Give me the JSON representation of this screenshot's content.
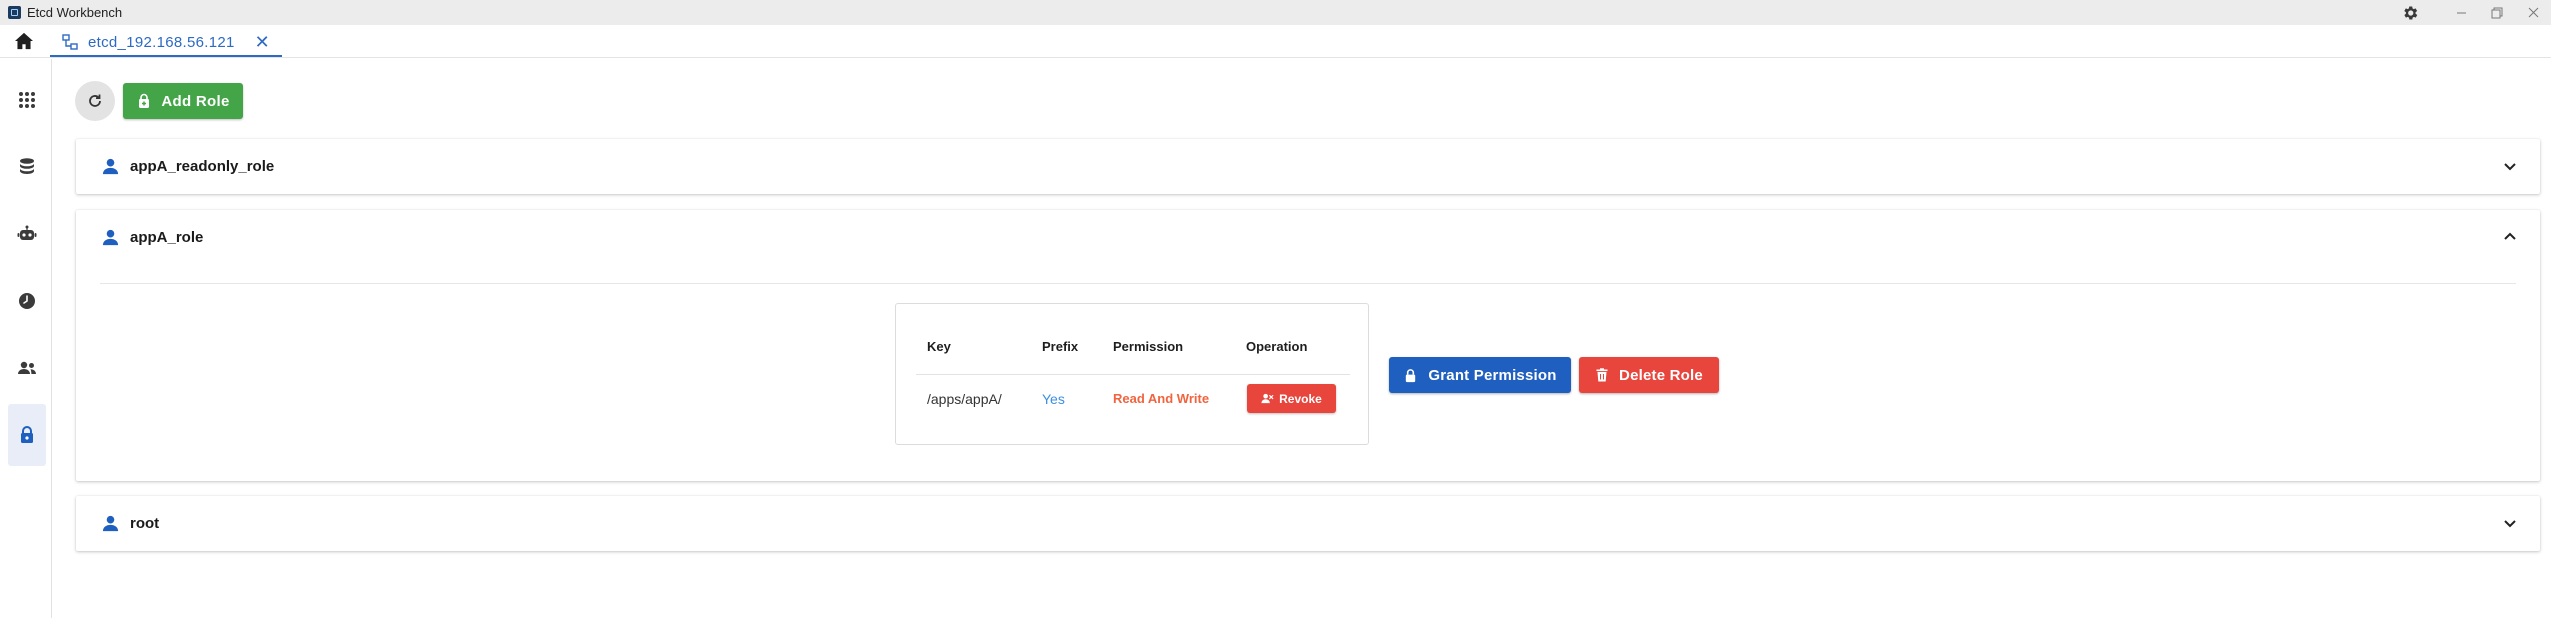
{
  "window": {
    "title": "Etcd Workbench"
  },
  "tabs": [
    {
      "label": "etcd_192.168.56.121"
    }
  ],
  "sidebar": {
    "items": [
      {
        "icon": "apps-grid-icon"
      },
      {
        "icon": "database-icon"
      },
      {
        "icon": "robot-icon"
      },
      {
        "icon": "clock-icon"
      },
      {
        "icon": "users-icon"
      },
      {
        "icon": "lock-icon",
        "active": true
      }
    ]
  },
  "toolbar": {
    "add_role_label": "Add Role"
  },
  "roles": [
    {
      "name": "appA_readonly_role",
      "expanded": false
    },
    {
      "name": "appA_role",
      "expanded": true,
      "table": {
        "headers": [
          "Key",
          "Prefix",
          "Permission",
          "Operation"
        ],
        "rows": [
          {
            "key": "/apps/appA/",
            "prefix": "Yes",
            "permission": "Read And Write",
            "operation": "Revoke"
          }
        ]
      },
      "grant_label": "Grant Permission",
      "delete_label": "Delete Role"
    },
    {
      "name": "root",
      "expanded": false
    }
  ],
  "colors": {
    "accent": "#1f5fbf",
    "success": "#44a548",
    "danger": "#e8453c",
    "prefix_yes": "#3d8fe0",
    "permission_rw": "#f0643f"
  }
}
